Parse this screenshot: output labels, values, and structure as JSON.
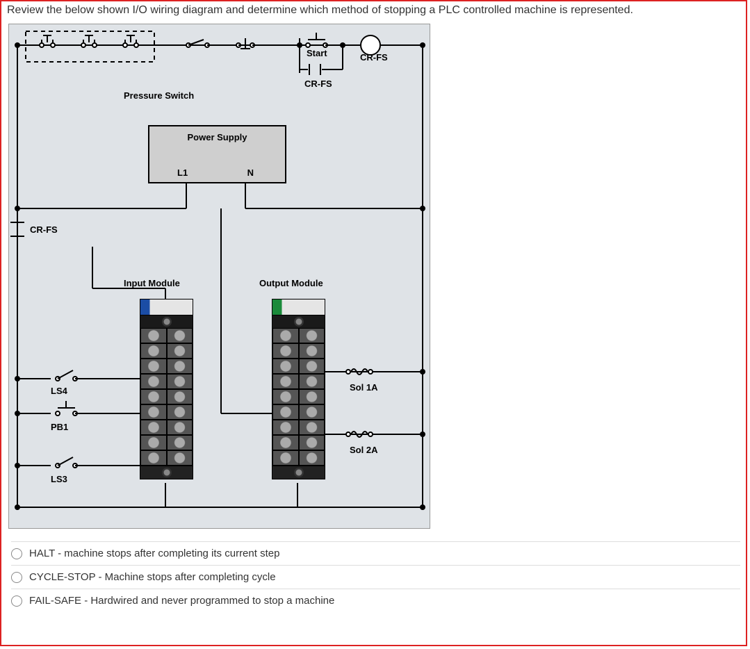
{
  "question": "Review the below shown I/O wiring diagram and determine which method of stopping a PLC controlled machine is represented.",
  "diagram": {
    "pressure_switch": "Pressure Switch",
    "start": "Start",
    "cr_fs_seal": "CR-FS",
    "cr_fs_coil": "CR-FS",
    "cr_fs_contact": "CR-FS",
    "power_supply": {
      "title": "Power Supply",
      "l1": "L1",
      "n": "N"
    },
    "input_module": "Input Module",
    "output_module": "Output Module",
    "ls4": "LS4",
    "pb1": "PB1",
    "ls3": "LS3",
    "sol1a": "Sol 1A",
    "sol2a": "Sol 2A"
  },
  "options": [
    "HALT - machine stops after completing its current step",
    "CYCLE-STOP - Machine stops after completing cycle",
    "FAIL-SAFE - Hardwired and never programmed to stop a machine"
  ]
}
